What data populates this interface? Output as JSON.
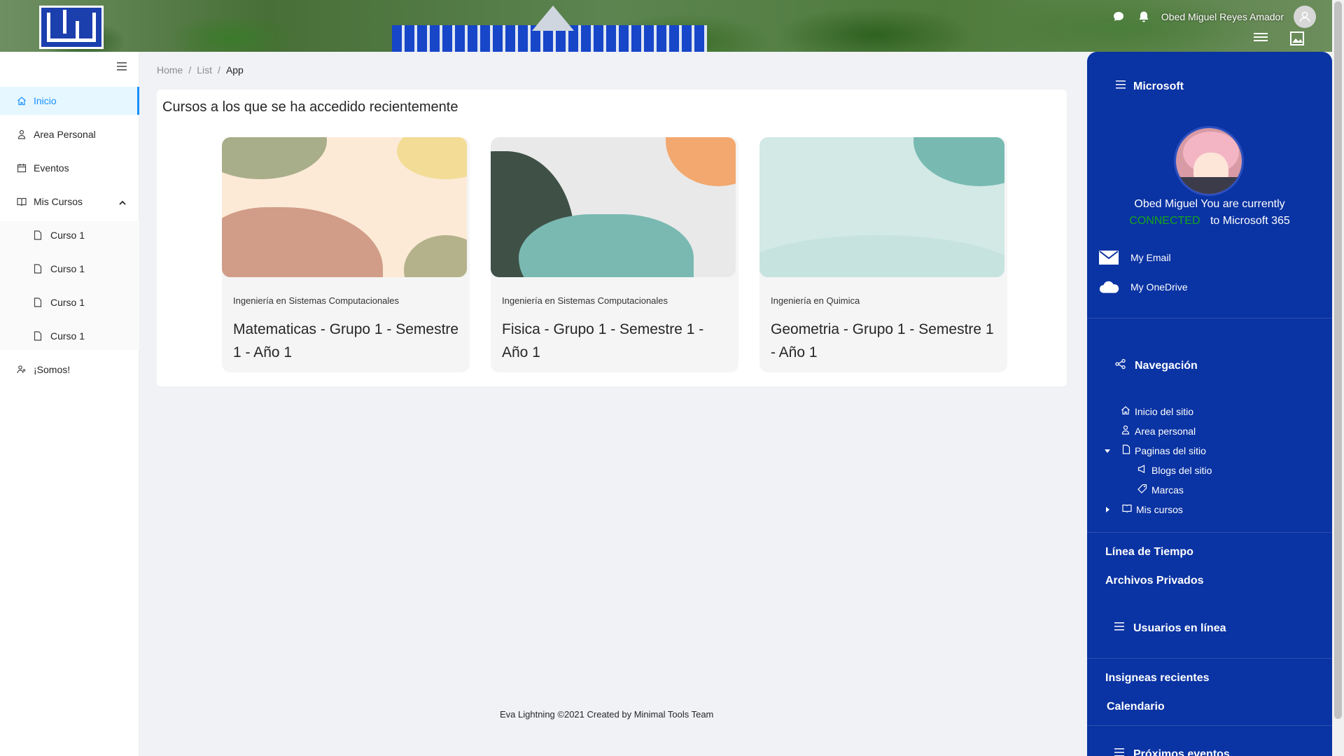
{
  "header": {
    "user_name": "Obed Miguel Reyes Amador",
    "icons": [
      "chat-icon",
      "bell-icon",
      "user-avatar-icon",
      "menu-icon",
      "image-icon"
    ]
  },
  "sidebar": {
    "items": [
      {
        "label": "Inicio",
        "icon": "home-icon",
        "active": true
      },
      {
        "label": "Area Personal",
        "icon": "person-icon"
      },
      {
        "label": "Eventos",
        "icon": "calendar-icon"
      },
      {
        "label": "Mis Cursos",
        "icon": "book-icon",
        "expanded": true
      },
      {
        "label": "¡Somos!",
        "icon": "team-icon"
      }
    ],
    "sub_items": [
      "Curso 1",
      "Curso 1",
      "Curso 1",
      "Curso 1"
    ]
  },
  "breadcrumb": [
    "Home",
    "List",
    "App"
  ],
  "main": {
    "title": "Cursos a los que se ha accedido recientemente",
    "courses": [
      {
        "category": "Ingeniería en Sistemas Computacionales",
        "name": "Matematicas - Grupo 1 - Semestre 1 - Año 1"
      },
      {
        "category": "Ingeniería en Sistemas Computacionales",
        "name": "Fisica - Grupo 1 - Semestre 1 - Año 1"
      },
      {
        "category": "Ingeniería en Quimica",
        "name": "Geometria - Grupo 1 - Semestre 1 - Año 1"
      }
    ]
  },
  "footer": "Eva Lightning ©2021 Created by Minimal Tools Team",
  "right_panel": {
    "title": "Microsoft",
    "status_prefix": "Obed Miguel You are currently",
    "status_connected": "CONNECTED",
    "status_suffix": "to Microsoft 365",
    "links": [
      "My Email",
      "My OneDrive"
    ],
    "nav_title": "Navegación",
    "nav_items": [
      "Inicio del sitio",
      "Area personal",
      "Paginas del sitio",
      "Blogs del sitio",
      "Marcas",
      "Mis cursos"
    ],
    "bold_links": [
      "Línea de Tiempo",
      "Archivos Privados"
    ],
    "online_users": "Usuarios en línea",
    "bold_links2": [
      "Insigneas recientes",
      "Calendario"
    ],
    "upcoming": "Próximos eventos"
  },
  "colors": {
    "primary": "#1890ff",
    "panel": "#0a33a3",
    "connected": "#17a51b"
  }
}
